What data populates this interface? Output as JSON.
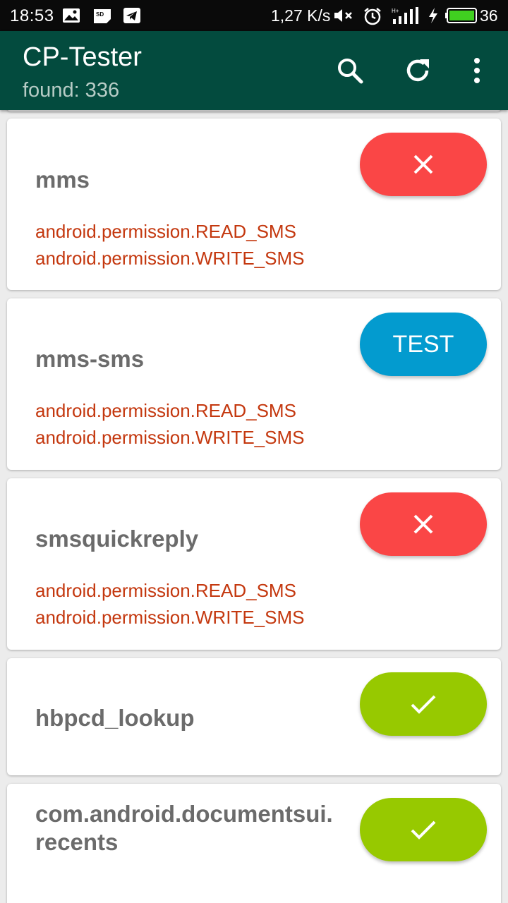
{
  "status_bar": {
    "time": "18:53",
    "net_speed": "1,27 K/s",
    "battery": "36",
    "icons": [
      "image-notification-icon",
      "sd-card-icon",
      "telegram-icon",
      "mute-icon",
      "alarm-icon",
      "signal-icon",
      "charging-icon",
      "battery-icon"
    ]
  },
  "app_bar": {
    "title": "CP-Tester",
    "subtitle": "found: 336",
    "actions": [
      "search-icon",
      "refresh-icon",
      "more-vert-icon"
    ]
  },
  "colors": {
    "app_bar": "#034b3e",
    "fail": "#fa4646",
    "test": "#039bcf",
    "pass": "#97c900",
    "permission_text": "#c4380f",
    "name_text": "#6b6b6b"
  },
  "providers": [
    {
      "name": "mms",
      "permissions": [
        "android.permission.READ_SMS",
        "android.permission.WRITE_SMS"
      ],
      "status": "fail",
      "button_label": ""
    },
    {
      "name": "mms-sms",
      "permissions": [
        "android.permission.READ_SMS",
        "android.permission.WRITE_SMS"
      ],
      "status": "test",
      "button_label": "TEST"
    },
    {
      "name": "smsquickreply",
      "permissions": [
        "android.permission.READ_SMS",
        "android.permission.WRITE_SMS"
      ],
      "status": "fail",
      "button_label": ""
    },
    {
      "name": "hbpcd_lookup",
      "permissions": [],
      "status": "pass",
      "button_label": ""
    },
    {
      "name": "com.android.documentsui.\nrecents",
      "permissions": [],
      "status": "pass",
      "button_label": ""
    }
  ]
}
